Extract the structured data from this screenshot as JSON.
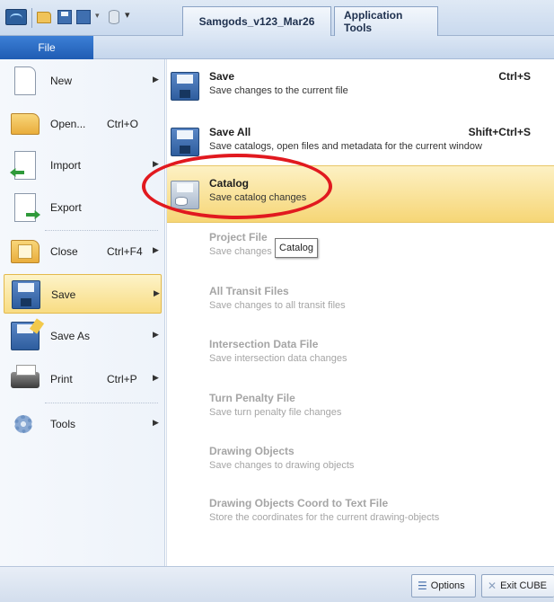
{
  "titlebar": {
    "document_tab": "Samgods_v123_Mar26",
    "context_tab": "Application Tools",
    "quick_dropdown_glyph": "▾",
    "customize_glyph": "▾"
  },
  "ribbon": {
    "file_tab": "File"
  },
  "left_menu": {
    "items": [
      {
        "label": "New",
        "shortcut": "",
        "arrow": "▶",
        "icon": "new-document-icon"
      },
      {
        "label": "Open...",
        "shortcut": "Ctrl+O",
        "arrow": "",
        "icon": "open-folder-icon"
      },
      {
        "label": "Import",
        "shortcut": "",
        "arrow": "▶",
        "icon": "import-icon"
      },
      {
        "label": "Export",
        "shortcut": "",
        "arrow": "",
        "icon": "export-icon"
      },
      {
        "label": "Close",
        "shortcut": "Ctrl+F4",
        "arrow": "▶",
        "icon": "close-folder-icon"
      },
      {
        "label": "Save",
        "shortcut": "",
        "arrow": "▶",
        "icon": "save-icon",
        "selected": true
      },
      {
        "label": "Save As",
        "shortcut": "",
        "arrow": "▶",
        "icon": "save-as-icon"
      },
      {
        "label": "Print",
        "shortcut": "Ctrl+P",
        "arrow": "▶",
        "icon": "printer-icon"
      },
      {
        "label": "Tools",
        "shortcut": "",
        "arrow": "▶",
        "icon": "tools-gear-icon"
      }
    ]
  },
  "submenu": {
    "items": [
      {
        "title": "Save",
        "description": "Save changes to the current file",
        "shortcut": "Ctrl+S",
        "enabled": true
      },
      {
        "title": "Save All",
        "description": "Save catalogs, open files and metadata for the current window",
        "shortcut": "Shift+Ctrl+S",
        "enabled": true
      },
      {
        "title": "Catalog",
        "description": "Save catalog changes",
        "shortcut": "",
        "enabled": true,
        "highlighted": true
      },
      {
        "title": "Project File",
        "description": "Save changes to PR file",
        "shortcut": "",
        "enabled": false
      },
      {
        "title": "All Transit Files",
        "description": "Save changes to all transit files",
        "shortcut": "",
        "enabled": false
      },
      {
        "title": "Intersection Data File",
        "description": "Save intersection data changes",
        "shortcut": "",
        "enabled": false
      },
      {
        "title": "Turn Penalty File",
        "description": "Save turn penalty file changes",
        "shortcut": "",
        "enabled": false
      },
      {
        "title": "Drawing Objects",
        "description": "Save changes to drawing objects",
        "shortcut": "",
        "enabled": false
      },
      {
        "title": "Drawing Objects Coord to Text File",
        "description": "Store the coordinates for the current drawing-objects",
        "shortcut": "",
        "enabled": false
      }
    ],
    "tooltip": "Catalog"
  },
  "bottombar": {
    "options_label": "Options",
    "exit_label": "Exit CUBE"
  },
  "colors": {
    "highlight": "#f6d676",
    "annotation_ring": "#e1191f",
    "file_tab": "#1f5cb3",
    "disabled_text": "#a5a5a5"
  }
}
